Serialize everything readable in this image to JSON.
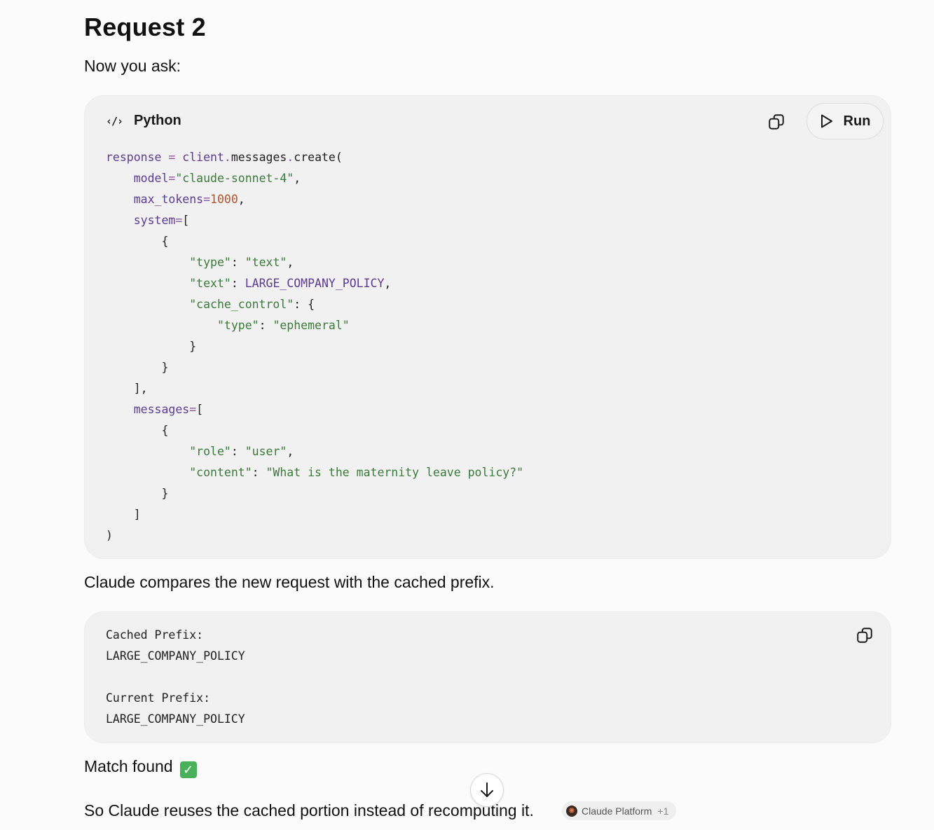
{
  "heading": "Request 2",
  "intro_text": "Now you ask:",
  "code_block_1": {
    "language": "Python",
    "run_label": "Run",
    "lines": [
      [
        [
          "kw",
          "response"
        ],
        [
          "op",
          " = "
        ],
        [
          "kw",
          "client"
        ],
        [
          "op",
          "."
        ],
        [
          "pn",
          "messages"
        ],
        [
          "op",
          "."
        ],
        [
          "pn",
          "create("
        ]
      ],
      [
        [
          "pn",
          "    "
        ],
        [
          "kw",
          "model"
        ],
        [
          "op",
          "="
        ],
        [
          "str",
          "\"claude-sonnet-4\""
        ],
        [
          "pn",
          ","
        ]
      ],
      [
        [
          "pn",
          "    "
        ],
        [
          "kw",
          "max_tokens"
        ],
        [
          "op",
          "="
        ],
        [
          "num",
          "1000"
        ],
        [
          "pn",
          ","
        ]
      ],
      [
        [
          "pn",
          "    "
        ],
        [
          "kw",
          "system"
        ],
        [
          "op",
          "="
        ],
        [
          "pn",
          "["
        ]
      ],
      [
        [
          "pn",
          "        {"
        ]
      ],
      [
        [
          "pn",
          "            "
        ],
        [
          "str",
          "\"type\""
        ],
        [
          "pn",
          ": "
        ],
        [
          "str",
          "\"text\""
        ],
        [
          "pn",
          ","
        ]
      ],
      [
        [
          "pn",
          "            "
        ],
        [
          "str",
          "\"text\""
        ],
        [
          "pn",
          ": "
        ],
        [
          "kw",
          "LARGE_COMPANY_POLICY"
        ],
        [
          "pn",
          ","
        ]
      ],
      [
        [
          "pn",
          "            "
        ],
        [
          "str",
          "\"cache_control\""
        ],
        [
          "pn",
          ": {"
        ]
      ],
      [
        [
          "pn",
          "                "
        ],
        [
          "str",
          "\"type\""
        ],
        [
          "pn",
          ": "
        ],
        [
          "str",
          "\"ephemeral\""
        ]
      ],
      [
        [
          "pn",
          "            }"
        ]
      ],
      [
        [
          "pn",
          "        }"
        ]
      ],
      [
        [
          "pn",
          "    ],"
        ]
      ],
      [
        [
          "pn",
          "    "
        ],
        [
          "kw",
          "messages"
        ],
        [
          "op",
          "="
        ],
        [
          "pn",
          "["
        ]
      ],
      [
        [
          "pn",
          "        {"
        ]
      ],
      [
        [
          "pn",
          "            "
        ],
        [
          "str",
          "\"role\""
        ],
        [
          "pn",
          ": "
        ],
        [
          "str",
          "\"user\""
        ],
        [
          "pn",
          ","
        ]
      ],
      [
        [
          "pn",
          "            "
        ],
        [
          "str",
          "\"content\""
        ],
        [
          "pn",
          ": "
        ],
        [
          "str",
          "\"What is the maternity leave policy?\""
        ]
      ],
      [
        [
          "pn",
          "        }"
        ]
      ],
      [
        [
          "pn",
          "    ]"
        ]
      ],
      [
        [
          "pn",
          ")"
        ]
      ]
    ]
  },
  "compare_text": "Claude compares the new request with the cached prefix.",
  "code_block_2": {
    "lines": [
      "Cached Prefix:",
      "LARGE_COMPANY_POLICY",
      "",
      "Current Prefix:",
      "LARGE_COMPANY_POLICY"
    ]
  },
  "match_text": "Match found",
  "match_emoji": "✓",
  "reuse_text": "So Claude reuses the cached portion instead of recomputing it.",
  "source_chip": {
    "label": "Claude Platform",
    "count": "+1"
  },
  "colors": {
    "keyword": "#5b3c8f",
    "string": "#3a7a3a",
    "number": "#b0552a",
    "card_bg": "#f1f1f1",
    "match_green": "#4ab05a"
  }
}
